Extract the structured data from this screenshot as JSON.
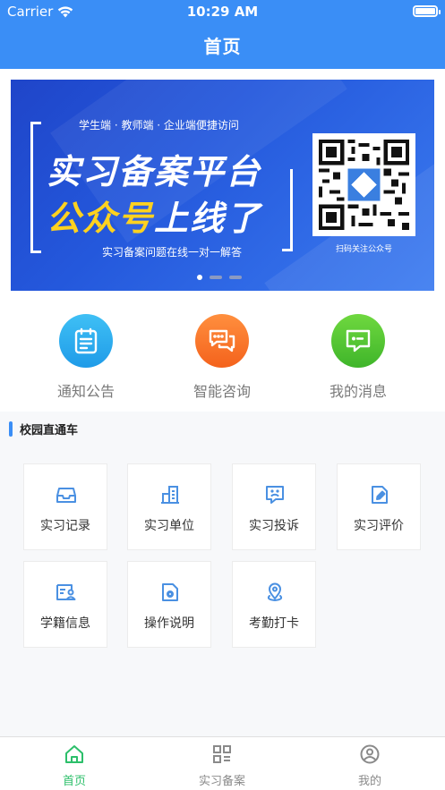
{
  "status_bar": {
    "carrier": "Carrier",
    "time": "10:29 AM"
  },
  "header": {
    "title": "首页"
  },
  "banner": {
    "subtitle": "学生端 · 教师端 · 企业端便捷访问",
    "title_line1": "实习备案平台",
    "title_line2_highlight": "公众号",
    "title_line2_rest": "上线了",
    "footer": "实习备案问题在线一对一解答",
    "qr_caption": "扫码关注公众号",
    "highlight_color": "#ffd21f"
  },
  "quick_actions": [
    {
      "label": "通知公告",
      "icon": "clipboard-icon"
    },
    {
      "label": "智能咨询",
      "icon": "chat-icon"
    },
    {
      "label": "我的消息",
      "icon": "message-icon"
    }
  ],
  "section": {
    "title": "校园直通车"
  },
  "grid": [
    {
      "label": "实习记录",
      "icon": "inbox-icon"
    },
    {
      "label": "实习单位",
      "icon": "building-icon"
    },
    {
      "label": "实习投诉",
      "icon": "complaint-icon"
    },
    {
      "label": "实习评价",
      "icon": "edit-doc-icon"
    },
    {
      "label": "学籍信息",
      "icon": "id-card-icon"
    },
    {
      "label": "操作说明",
      "icon": "gear-doc-icon"
    },
    {
      "label": "考勤打卡",
      "icon": "location-icon"
    }
  ],
  "tabbar": [
    {
      "label": "首页",
      "icon": "home-icon",
      "active": true
    },
    {
      "label": "实习备案",
      "icon": "grid-icon",
      "active": false
    },
    {
      "label": "我的",
      "icon": "user-icon",
      "active": false
    }
  ],
  "colors": {
    "primary": "#3a8ef6",
    "active_tab": "#2cbf6a"
  }
}
